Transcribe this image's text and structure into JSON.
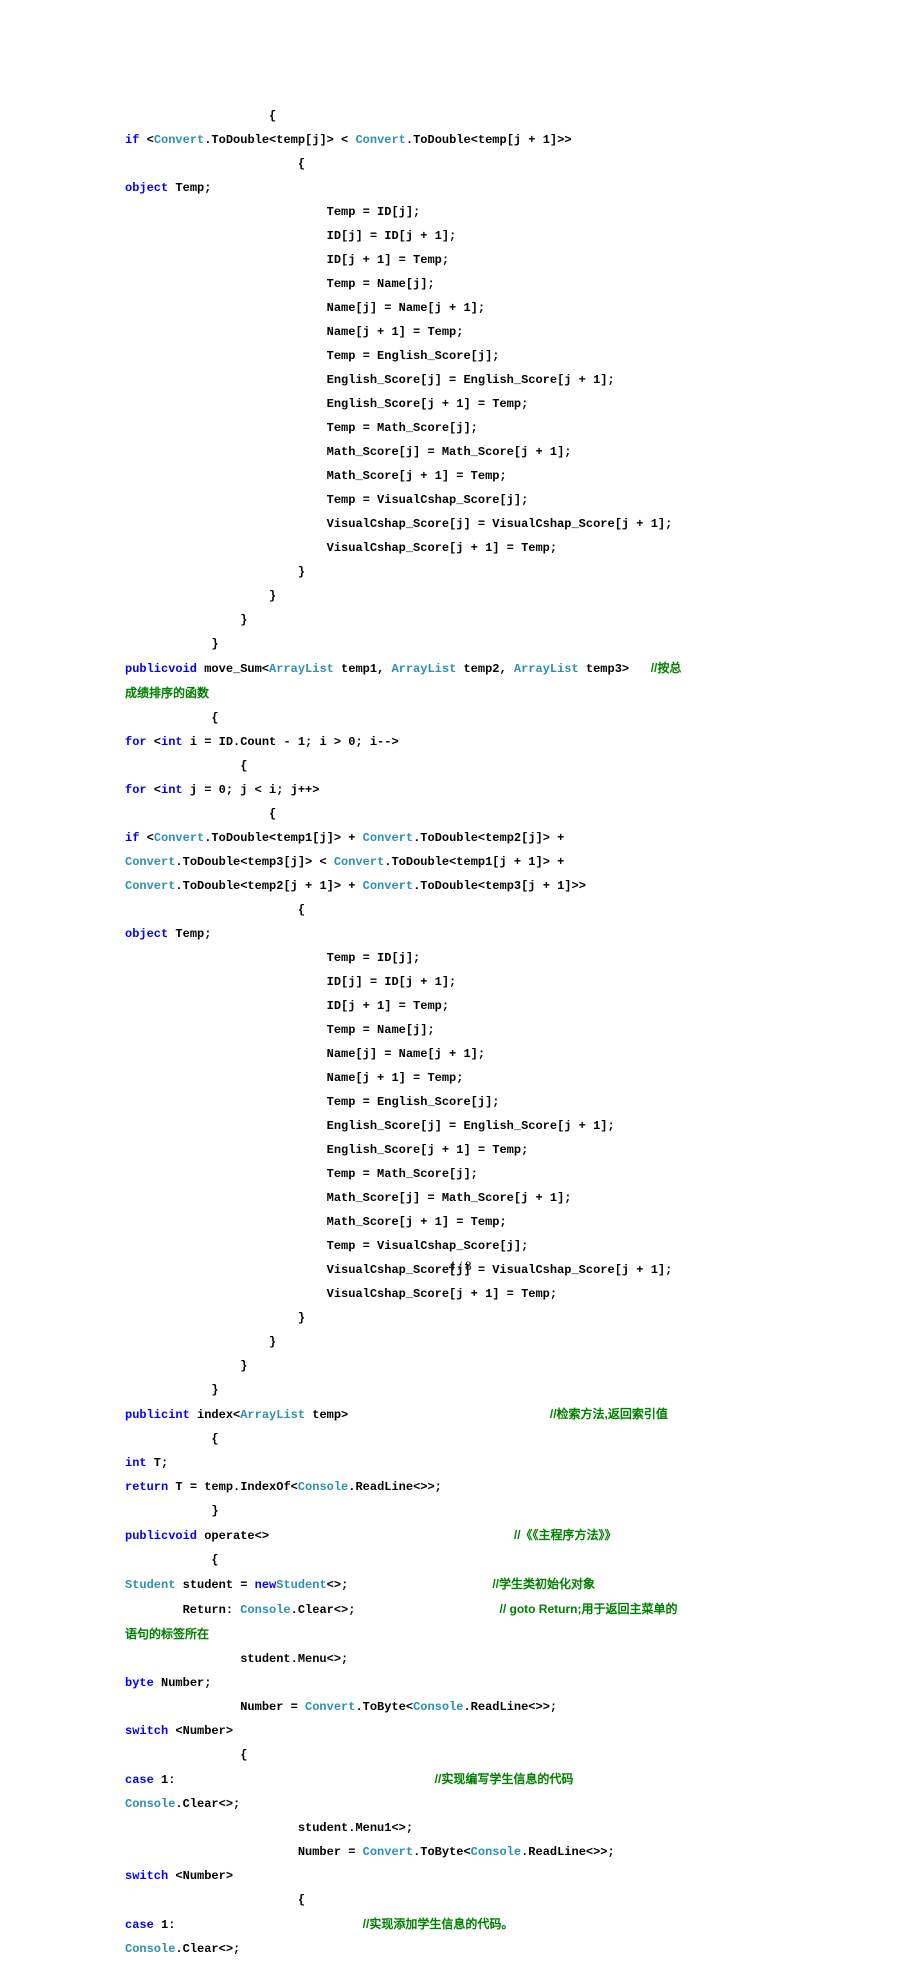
{
  "lines": [
    {
      "indent": "                    ",
      "parts": [
        {
          "c": "txt",
          "t": "{"
        }
      ]
    },
    {
      "indent": "",
      "parts": [
        {
          "c": "kw",
          "t": "if"
        },
        {
          "c": "txt",
          "t": " <"
        },
        {
          "c": "type",
          "t": "Convert"
        },
        {
          "c": "txt",
          "t": ".ToDouble<temp[j]> < "
        },
        {
          "c": "type",
          "t": "Convert"
        },
        {
          "c": "txt",
          "t": ".ToDouble<temp[j + 1]>>"
        }
      ]
    },
    {
      "indent": "                        ",
      "parts": [
        {
          "c": "txt",
          "t": "{"
        }
      ]
    },
    {
      "indent": "",
      "parts": [
        {
          "c": "kw",
          "t": "object"
        },
        {
          "c": "txt",
          "t": " Temp;"
        }
      ]
    },
    {
      "indent": "                            ",
      "parts": [
        {
          "c": "txt",
          "t": "Temp = ID[j];"
        }
      ]
    },
    {
      "indent": "                            ",
      "parts": [
        {
          "c": "txt",
          "t": "ID[j] = ID[j + 1];"
        }
      ]
    },
    {
      "indent": "                            ",
      "parts": [
        {
          "c": "txt",
          "t": "ID[j + 1] = Temp;"
        }
      ]
    },
    {
      "indent": "                            ",
      "parts": [
        {
          "c": "txt",
          "t": "Temp = Name[j];"
        }
      ]
    },
    {
      "indent": "                            ",
      "parts": [
        {
          "c": "txt",
          "t": "Name[j] = Name[j + 1];"
        }
      ]
    },
    {
      "indent": "                            ",
      "parts": [
        {
          "c": "txt",
          "t": "Name[j + 1] = Temp;"
        }
      ]
    },
    {
      "indent": "                            ",
      "parts": [
        {
          "c": "txt",
          "t": "Temp = English_Score[j];"
        }
      ]
    },
    {
      "indent": "                            ",
      "parts": [
        {
          "c": "txt",
          "t": "English_Score[j] = English_Score[j + 1];"
        }
      ]
    },
    {
      "indent": "                            ",
      "parts": [
        {
          "c": "txt",
          "t": "English_Score[j + 1] = Temp;"
        }
      ]
    },
    {
      "indent": "                            ",
      "parts": [
        {
          "c": "txt",
          "t": "Temp = Math_Score[j];"
        }
      ]
    },
    {
      "indent": "                            ",
      "parts": [
        {
          "c": "txt",
          "t": "Math_Score[j] = Math_Score[j + 1];"
        }
      ]
    },
    {
      "indent": "                            ",
      "parts": [
        {
          "c": "txt",
          "t": "Math_Score[j + 1] = Temp;"
        }
      ]
    },
    {
      "indent": "                            ",
      "parts": [
        {
          "c": "txt",
          "t": "Temp = VisualCshap_Score[j];"
        }
      ]
    },
    {
      "indent": "                            ",
      "parts": [
        {
          "c": "txt",
          "t": "VisualCshap_Score[j] = VisualCshap_Score[j + 1];"
        }
      ]
    },
    {
      "indent": "                            ",
      "parts": [
        {
          "c": "txt",
          "t": "VisualCshap_Score[j + 1] = Temp;"
        }
      ]
    },
    {
      "indent": "                        ",
      "parts": [
        {
          "c": "txt",
          "t": "}"
        }
      ]
    },
    {
      "indent": "                    ",
      "parts": [
        {
          "c": "txt",
          "t": "}"
        }
      ]
    },
    {
      "indent": "                ",
      "parts": [
        {
          "c": "txt",
          "t": "}"
        }
      ]
    },
    {
      "indent": "            ",
      "parts": [
        {
          "c": "txt",
          "t": "}"
        }
      ]
    },
    {
      "indent": "",
      "parts": [
        {
          "c": "kw",
          "t": "publicvoid"
        },
        {
          "c": "txt",
          "t": " move_Sum<"
        },
        {
          "c": "type",
          "t": "ArrayList"
        },
        {
          "c": "txt",
          "t": " temp1, "
        },
        {
          "c": "type",
          "t": "ArrayList"
        },
        {
          "c": "txt",
          "t": " temp2, "
        },
        {
          "c": "type",
          "t": "ArrayList"
        },
        {
          "c": "txt",
          "t": " temp3>   "
        },
        {
          "c": "cmt",
          "t": "//按总"
        }
      ]
    },
    {
      "indent": "",
      "parts": [
        {
          "c": "cmt",
          "t": "成绩排序的函数"
        }
      ]
    },
    {
      "indent": "            ",
      "parts": [
        {
          "c": "txt",
          "t": "{"
        }
      ]
    },
    {
      "indent": "",
      "parts": [
        {
          "c": "kw",
          "t": "for"
        },
        {
          "c": "txt",
          "t": " <"
        },
        {
          "c": "kw",
          "t": "int"
        },
        {
          "c": "txt",
          "t": " i = ID.Count - 1; i > 0; i-->"
        }
      ]
    },
    {
      "indent": "                ",
      "parts": [
        {
          "c": "txt",
          "t": "{"
        }
      ]
    },
    {
      "indent": "",
      "parts": [
        {
          "c": "kw",
          "t": "for"
        },
        {
          "c": "txt",
          "t": " <"
        },
        {
          "c": "kw",
          "t": "int"
        },
        {
          "c": "txt",
          "t": " j = 0; j < i; j++>"
        }
      ]
    },
    {
      "indent": "                    ",
      "parts": [
        {
          "c": "txt",
          "t": "{"
        }
      ]
    },
    {
      "indent": "",
      "parts": [
        {
          "c": "kw",
          "t": "if"
        },
        {
          "c": "txt",
          "t": " <"
        },
        {
          "c": "type",
          "t": "Convert"
        },
        {
          "c": "txt",
          "t": ".ToDouble<temp1[j]> + "
        },
        {
          "c": "type",
          "t": "Convert"
        },
        {
          "c": "txt",
          "t": ".ToDouble<temp2[j]> + "
        }
      ]
    },
    {
      "indent": "",
      "parts": [
        {
          "c": "type",
          "t": "Convert"
        },
        {
          "c": "txt",
          "t": ".ToDouble<temp3[j]> < "
        },
        {
          "c": "type",
          "t": "Convert"
        },
        {
          "c": "txt",
          "t": ".ToDouble<temp1[j + 1]> + "
        }
      ]
    },
    {
      "indent": "",
      "parts": [
        {
          "c": "type",
          "t": "Convert"
        },
        {
          "c": "txt",
          "t": ".ToDouble<temp2[j + 1]> + "
        },
        {
          "c": "type",
          "t": "Convert"
        },
        {
          "c": "txt",
          "t": ".ToDouble<temp3[j + 1]>>"
        }
      ]
    },
    {
      "indent": "                        ",
      "parts": [
        {
          "c": "txt",
          "t": "{"
        }
      ]
    },
    {
      "indent": "",
      "parts": [
        {
          "c": "kw",
          "t": "object"
        },
        {
          "c": "txt",
          "t": " Temp;"
        }
      ]
    },
    {
      "indent": "                            ",
      "parts": [
        {
          "c": "txt",
          "t": "Temp = ID[j];"
        }
      ]
    },
    {
      "indent": "                            ",
      "parts": [
        {
          "c": "txt",
          "t": "ID[j] = ID[j + 1];"
        }
      ]
    },
    {
      "indent": "                            ",
      "parts": [
        {
          "c": "txt",
          "t": "ID[j + 1] = Temp;"
        }
      ]
    },
    {
      "indent": "                            ",
      "parts": [
        {
          "c": "txt",
          "t": "Temp = Name[j];"
        }
      ]
    },
    {
      "indent": "                            ",
      "parts": [
        {
          "c": "txt",
          "t": "Name[j] = Name[j + 1];"
        }
      ]
    },
    {
      "indent": "                            ",
      "parts": [
        {
          "c": "txt",
          "t": "Name[j + 1] = Temp;"
        }
      ]
    },
    {
      "indent": "                            ",
      "parts": [
        {
          "c": "txt",
          "t": "Temp = English_Score[j];"
        }
      ]
    },
    {
      "indent": "                            ",
      "parts": [
        {
          "c": "txt",
          "t": "English_Score[j] = English_Score[j + 1];"
        }
      ]
    },
    {
      "indent": "                            ",
      "parts": [
        {
          "c": "txt",
          "t": "English_Score[j + 1] = Temp;"
        }
      ]
    },
    {
      "indent": "                            ",
      "parts": [
        {
          "c": "txt",
          "t": "Temp = Math_Score[j];"
        }
      ]
    },
    {
      "indent": "                            ",
      "parts": [
        {
          "c": "txt",
          "t": "Math_Score[j] = Math_Score[j + 1];"
        }
      ]
    },
    {
      "indent": "                            ",
      "parts": [
        {
          "c": "txt",
          "t": "Math_Score[j + 1] = Temp;"
        }
      ]
    },
    {
      "indent": "                            ",
      "parts": [
        {
          "c": "txt",
          "t": "Temp = VisualCshap_Score[j];"
        }
      ]
    },
    {
      "indent": "                            ",
      "parts": [
        {
          "c": "txt",
          "t": "VisualCshap_Score[j] = VisualCshap_Score[j + 1];"
        }
      ]
    },
    {
      "indent": "                            ",
      "parts": [
        {
          "c": "txt",
          "t": "VisualCshap_Score[j + 1] = Temp;"
        }
      ]
    },
    {
      "indent": "                        ",
      "parts": [
        {
          "c": "txt",
          "t": "}"
        }
      ]
    },
    {
      "indent": "                    ",
      "parts": [
        {
          "c": "txt",
          "t": "}"
        }
      ]
    },
    {
      "indent": "                ",
      "parts": [
        {
          "c": "txt",
          "t": "}"
        }
      ]
    },
    {
      "indent": "            ",
      "parts": [
        {
          "c": "txt",
          "t": "}"
        }
      ]
    },
    {
      "indent": "",
      "parts": [
        {
          "c": "kw",
          "t": "publicint"
        },
        {
          "c": "txt",
          "t": " index<"
        },
        {
          "c": "type",
          "t": "ArrayList"
        },
        {
          "c": "txt",
          "t": " temp>                            "
        },
        {
          "c": "cmt",
          "t": "//检索方法,返回索引值"
        }
      ]
    },
    {
      "indent": "            ",
      "parts": [
        {
          "c": "txt",
          "t": "{"
        }
      ]
    },
    {
      "indent": "",
      "parts": [
        {
          "c": "kw",
          "t": "int"
        },
        {
          "c": "txt",
          "t": " T;"
        }
      ]
    },
    {
      "indent": "",
      "parts": [
        {
          "c": "kw",
          "t": "return"
        },
        {
          "c": "txt",
          "t": " T = temp.IndexOf<"
        },
        {
          "c": "type",
          "t": "Console"
        },
        {
          "c": "txt",
          "t": ".ReadLine<>>;"
        }
      ]
    },
    {
      "indent": "            ",
      "parts": [
        {
          "c": "txt",
          "t": "}"
        }
      ]
    },
    {
      "indent": "",
      "parts": [
        {
          "c": "kw",
          "t": "publicvoid"
        },
        {
          "c": "txt",
          "t": " operate<>                                  "
        },
        {
          "c": "cmt",
          "t": "//《《主程序方法》》"
        }
      ]
    },
    {
      "indent": "            ",
      "parts": [
        {
          "c": "txt",
          "t": "{"
        }
      ]
    },
    {
      "indent": "",
      "parts": [
        {
          "c": "type",
          "t": "Student"
        },
        {
          "c": "txt",
          "t": " student = "
        },
        {
          "c": "kw",
          "t": "new"
        },
        {
          "c": "type",
          "t": "Student"
        },
        {
          "c": "txt",
          "t": "<>;                    "
        },
        {
          "c": "cmt",
          "t": "//学生类初始化对象"
        }
      ]
    },
    {
      "indent": "        ",
      "parts": [
        {
          "c": "txt",
          "t": "Return: "
        },
        {
          "c": "type",
          "t": "Console"
        },
        {
          "c": "txt",
          "t": ".Clear<>;                    "
        },
        {
          "c": "cmt",
          "t": "// goto Return;用于返回主菜单的"
        }
      ]
    },
    {
      "indent": "",
      "parts": [
        {
          "c": "cmt",
          "t": "语句的标签所在"
        }
      ]
    },
    {
      "indent": "                ",
      "parts": [
        {
          "c": "txt",
          "t": "student.Menu<>;"
        }
      ]
    },
    {
      "indent": "",
      "parts": [
        {
          "c": "kw",
          "t": "byte"
        },
        {
          "c": "txt",
          "t": " Number;"
        }
      ]
    },
    {
      "indent": "                ",
      "parts": [
        {
          "c": "txt",
          "t": "Number = "
        },
        {
          "c": "type",
          "t": "Convert"
        },
        {
          "c": "txt",
          "t": ".ToByte<"
        },
        {
          "c": "type",
          "t": "Console"
        },
        {
          "c": "txt",
          "t": ".ReadLine<>>;"
        }
      ]
    },
    {
      "indent": "",
      "parts": [
        {
          "c": "kw",
          "t": "switch"
        },
        {
          "c": "txt",
          "t": " <Number>"
        }
      ]
    },
    {
      "indent": "                ",
      "parts": [
        {
          "c": "txt",
          "t": "{"
        }
      ]
    },
    {
      "indent": "",
      "parts": [
        {
          "c": "kw",
          "t": "case"
        },
        {
          "c": "txt",
          "t": " 1:                                    "
        },
        {
          "c": "cmt",
          "t": "//实现编写学生信息的代码"
        }
      ]
    },
    {
      "indent": "",
      "parts": [
        {
          "c": "type",
          "t": "Console"
        },
        {
          "c": "txt",
          "t": ".Clear<>;"
        }
      ]
    },
    {
      "indent": "                        ",
      "parts": [
        {
          "c": "txt",
          "t": "student.Menu1<>;"
        }
      ]
    },
    {
      "indent": "                        ",
      "parts": [
        {
          "c": "txt",
          "t": "Number = "
        },
        {
          "c": "type",
          "t": "Convert"
        },
        {
          "c": "txt",
          "t": ".ToByte<"
        },
        {
          "c": "type",
          "t": "Console"
        },
        {
          "c": "txt",
          "t": ".ReadLine<>>;"
        }
      ]
    },
    {
      "indent": "",
      "parts": [
        {
          "c": "kw",
          "t": "switch"
        },
        {
          "c": "txt",
          "t": " <Number>"
        }
      ]
    },
    {
      "indent": "                        ",
      "parts": [
        {
          "c": "txt",
          "t": "{"
        }
      ]
    },
    {
      "indent": "",
      "parts": [
        {
          "c": "kw",
          "t": "case"
        },
        {
          "c": "txt",
          "t": " 1:                          "
        },
        {
          "c": "cmt",
          "t": "//实现添加学生信息的代码。"
        }
      ]
    },
    {
      "indent": "",
      "parts": [
        {
          "c": "type",
          "t": "Console"
        },
        {
          "c": "txt",
          "t": ".Clear<>;"
        }
      ]
    }
  ],
  "page_number": "4 / 8"
}
